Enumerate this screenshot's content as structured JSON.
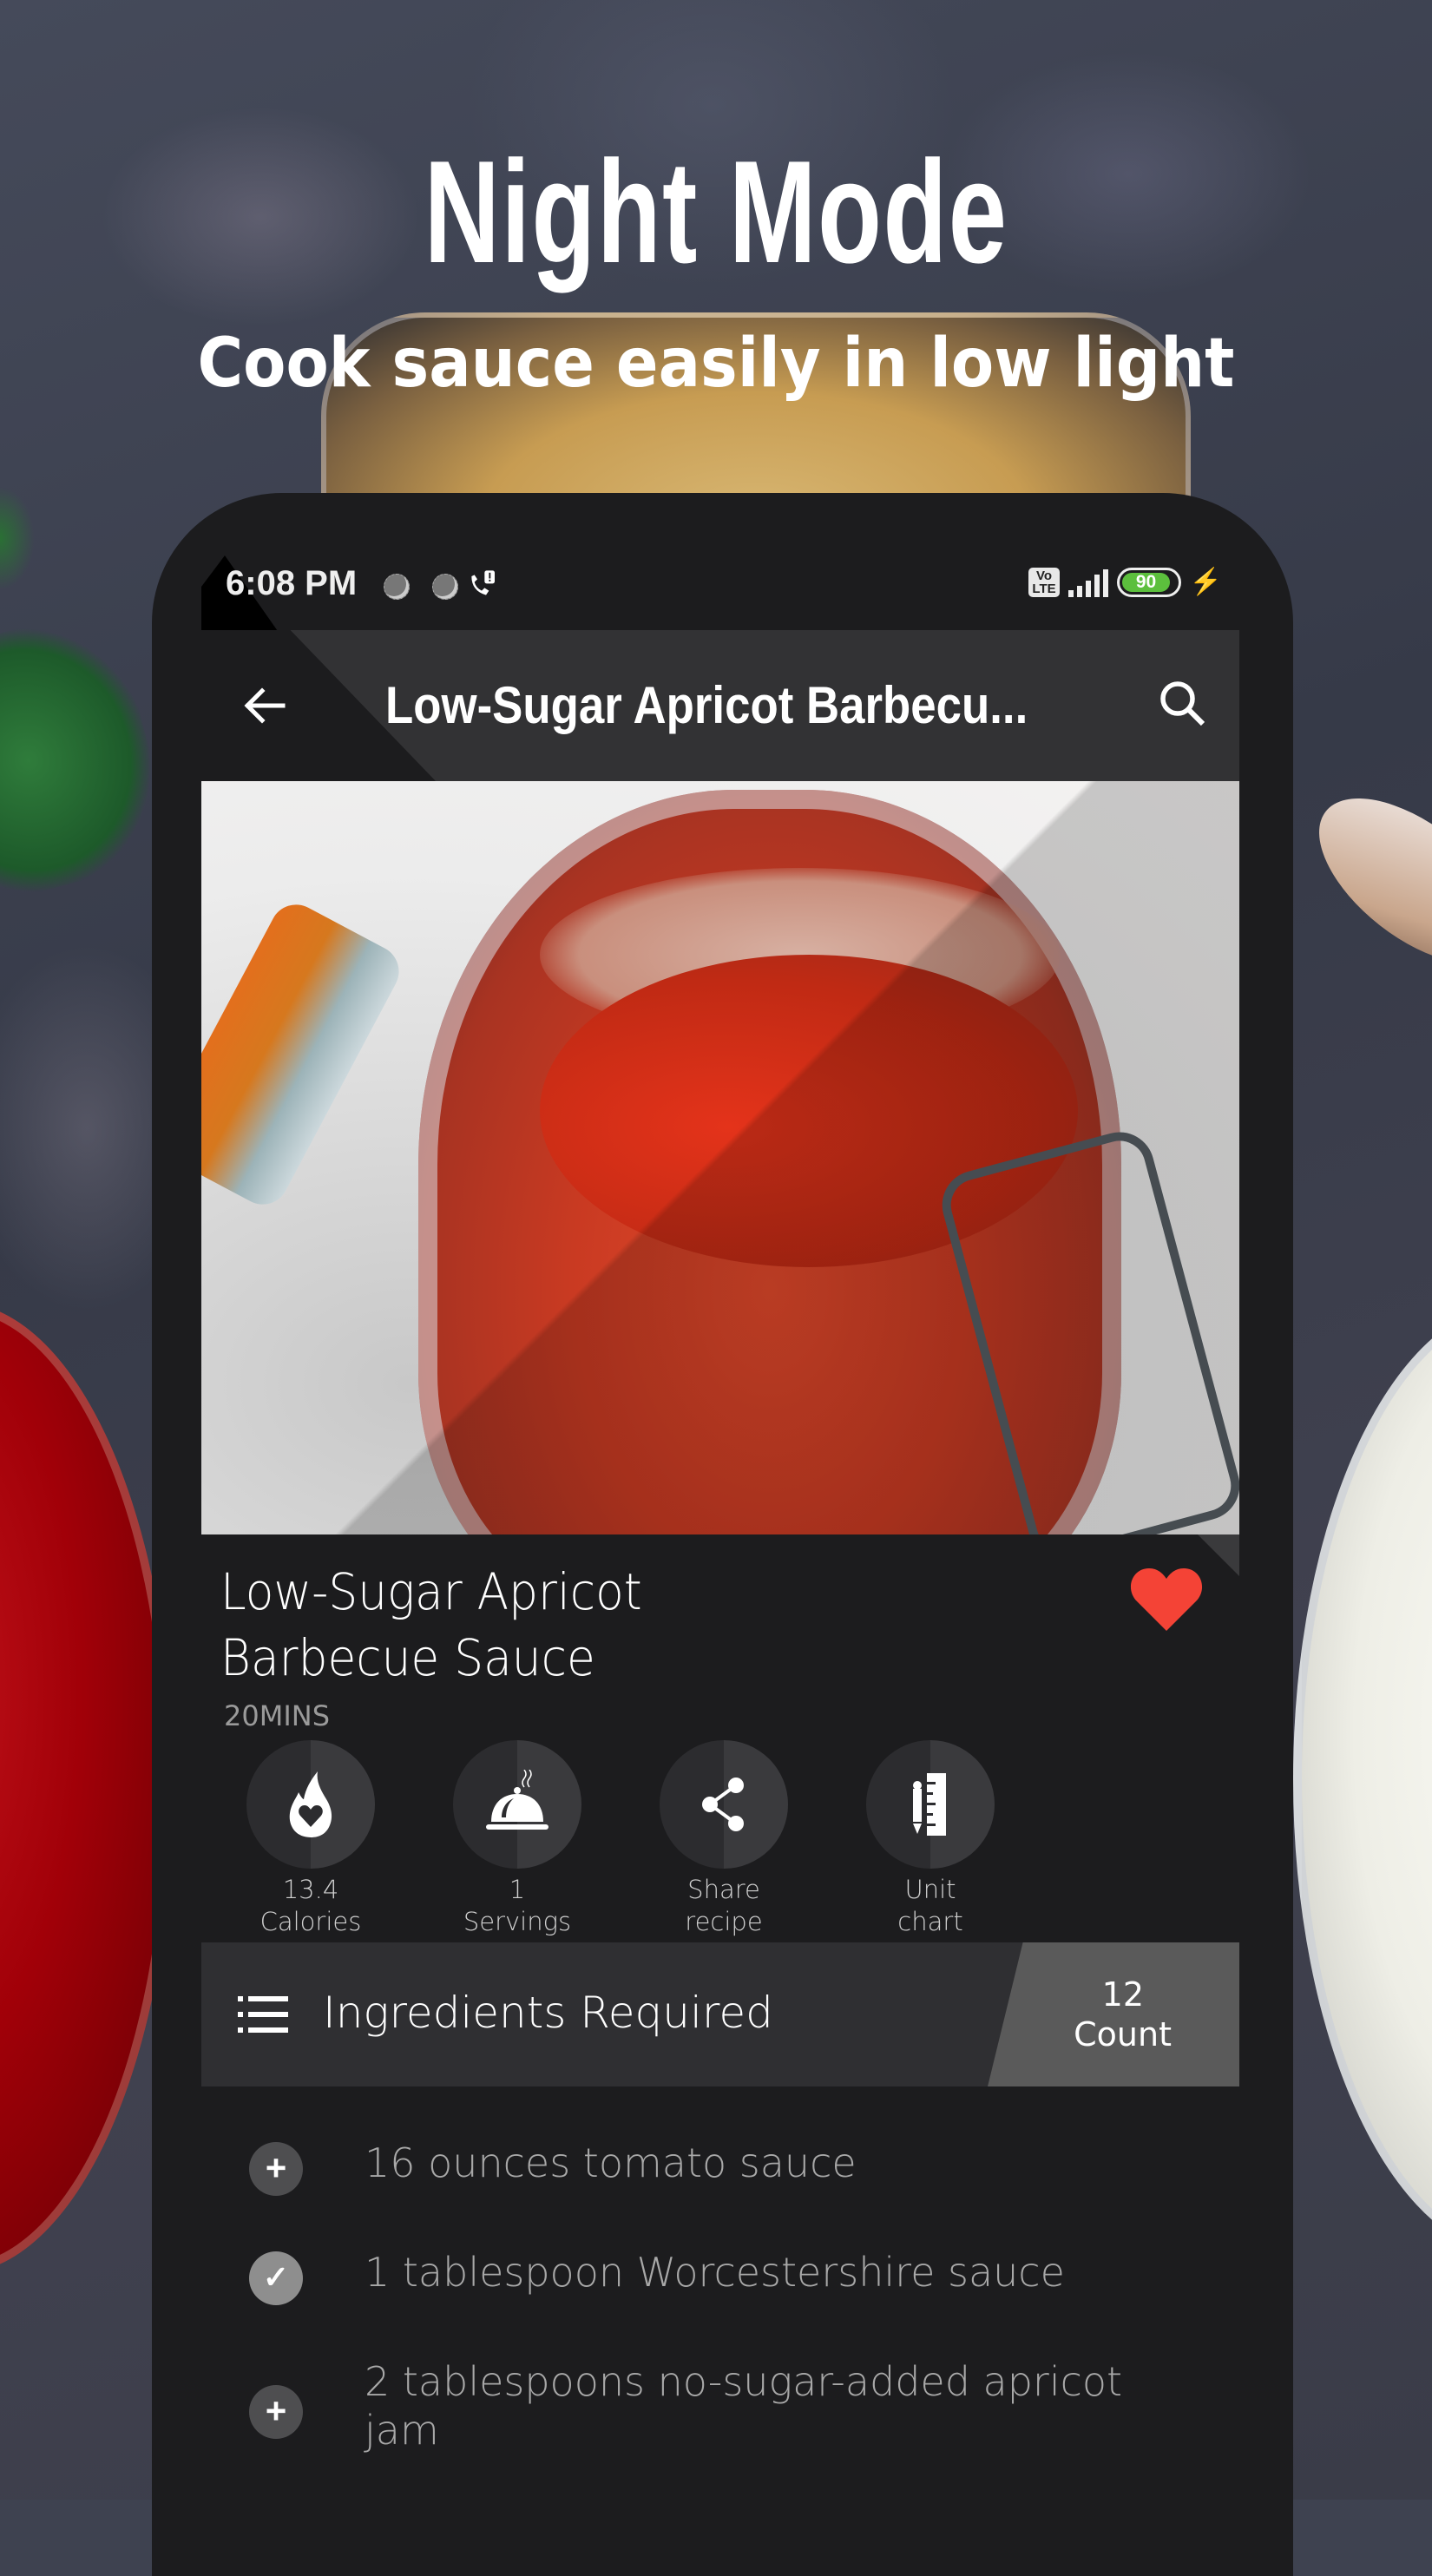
{
  "promo": {
    "title": "Night Mode",
    "subtitle": "Cook sauce easily in low light"
  },
  "status_bar": {
    "time": "6:08 PM",
    "network_badge": "Vo LTE",
    "battery_level": "90",
    "battery_percent": 90,
    "charging": true,
    "icons": [
      "notification-dot-icon",
      "notification-dot-icon",
      "call-alert-icon",
      "volte-icon",
      "signal-icon",
      "battery-icon",
      "charging-bolt-icon"
    ]
  },
  "toolbar": {
    "title": "Low-Sugar Apricot Barbecu...",
    "back_icon": "arrow-left-icon",
    "search_icon": "search-icon"
  },
  "recipe": {
    "image_alt": "Jar of barbecue sauce",
    "title_line1": "Low-Sugar Apricot",
    "title_line2": "Barbecue Sauce",
    "duration": "20MINS",
    "favorite": true,
    "favorite_color": "#f44336"
  },
  "actions": [
    {
      "icon": "flame-heart-icon",
      "line1": "13.4",
      "line2": "Calories"
    },
    {
      "icon": "serving-cloche-icon",
      "line1": "1",
      "line2": "Servings"
    },
    {
      "icon": "share-icon",
      "line1": "Share",
      "line2": "recipe"
    },
    {
      "icon": "ruler-pencil-icon",
      "line1": "Unit",
      "line2": "chart"
    }
  ],
  "ingredients": {
    "header_label": "Ingredients Required",
    "count": "12",
    "count_label": "Count",
    "items": [
      {
        "text": "16 ounces tomato sauce",
        "checked": false,
        "symbol": "+"
      },
      {
        "text": "1 tablespoon Worcestershire sauce",
        "checked": true,
        "symbol": "✓"
      },
      {
        "text": "2 tablespoons no-sugar-added apricot jam",
        "checked": false,
        "symbol": "+"
      }
    ]
  },
  "colors": {
    "surface": "#1c1c1e",
    "toolbar": "#323234",
    "battery_fill": "#5cbf3d",
    "heart": "#f44336"
  }
}
